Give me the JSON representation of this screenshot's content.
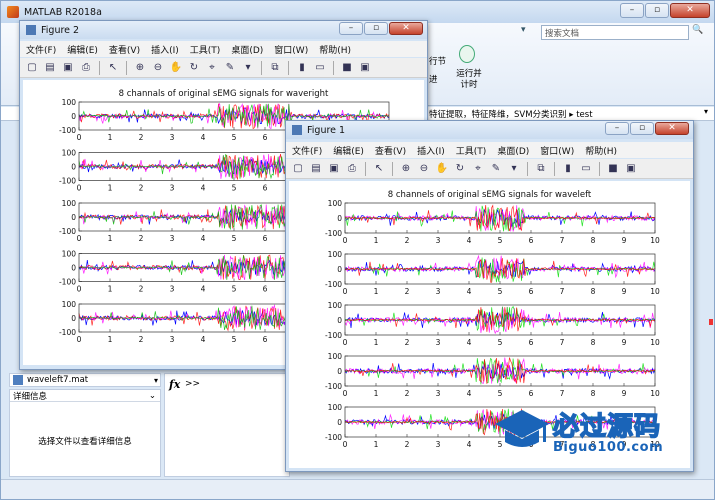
{
  "matlab": {
    "title": "MATLAB R2018a",
    "search_placeholder": "搜索文档",
    "ribbon_label_1": "行节",
    "ribbon_label_2": "进",
    "run_advance_label": "运行并\n计时",
    "path_text": "特征提取，特征降维，SVM分类识别  ▸  test",
    "current_file": "waveleft7.mat",
    "details_header": "详细信息",
    "details_hint": "选择文件以查看详细信息",
    "fx_prompt": ">>"
  },
  "figure_menu": [
    "文件(F)",
    "编辑(E)",
    "查看(V)",
    "插入(I)",
    "工具(T)",
    "桌面(D)",
    "窗口(W)",
    "帮助(H)"
  ],
  "figure2": {
    "title": "Figure 2",
    "plot_title": "8 channals of original sEMG signals for waveright"
  },
  "figure1": {
    "title": "Figure 1",
    "plot_title": "8 channels of original sEMG signals for waveleft"
  },
  "watermark": {
    "cn_text": "必过源码",
    "url": "Biguo100.com"
  },
  "chart_data": [
    {
      "type": "line",
      "title": "8 channals of original sEMG signals for waveright",
      "subplots": 5,
      "x_ticks": [
        0,
        1,
        2,
        3,
        4,
        5,
        6,
        7,
        8,
        9,
        10
      ],
      "y_ticks": [
        100,
        0,
        -100
      ],
      "xlim": [
        0,
        10
      ],
      "ylim": [
        -100,
        100
      ],
      "active_range": [
        4.5,
        6.8
      ],
      "series_colors": [
        "#0000ff",
        "#ff0000",
        "#ff00ff",
        "#00c000"
      ]
    },
    {
      "type": "line",
      "title": "8 channels of original sEMG signals for waveleft",
      "subplots": 5,
      "x_ticks": [
        0,
        1,
        2,
        3,
        4,
        5,
        6,
        7,
        8,
        9,
        10
      ],
      "y_ticks": [
        100,
        0,
        -100
      ],
      "xlim": [
        0,
        10
      ],
      "ylim": [
        -100,
        100
      ],
      "active_range": [
        4.2,
        5.8
      ],
      "series_colors": [
        "#0000ff",
        "#ff00ff",
        "#00dd00",
        "#ff0000"
      ]
    }
  ]
}
